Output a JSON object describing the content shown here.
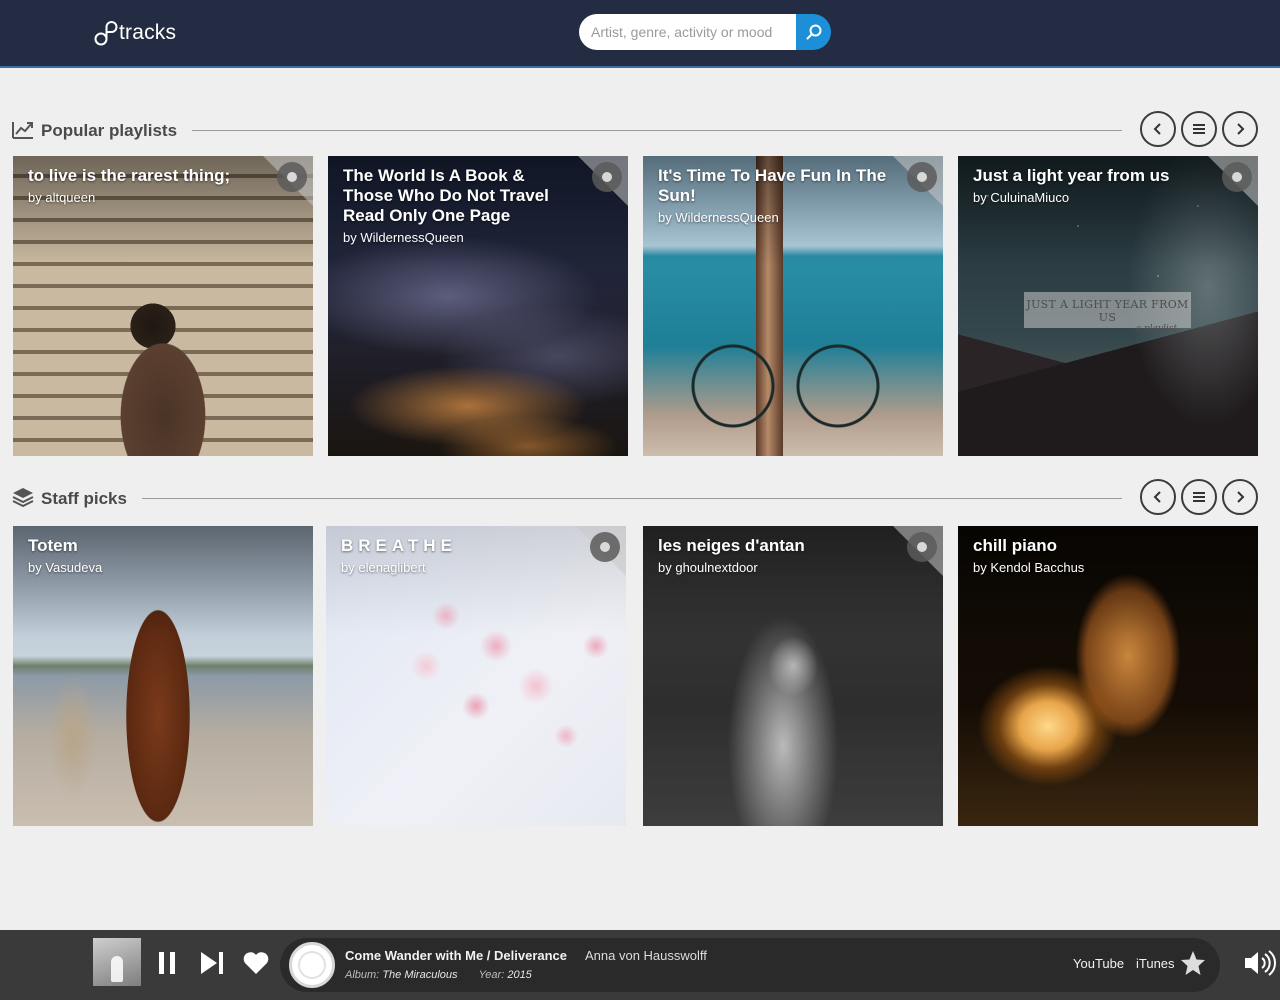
{
  "app": {
    "logo_text": "tracks"
  },
  "search": {
    "placeholder": "Artist, genre, activity or mood"
  },
  "sections": [
    {
      "title": "Popular playlists",
      "icon": "trending-icon",
      "cards": [
        {
          "title": "to live is the rarest thing;",
          "by": "by altqueen",
          "corner": true,
          "image": "library-woman"
        },
        {
          "title": "The World Is A Book & Those Who Do Not Travel Read Only One Page",
          "by": "by WildernessQueen",
          "corner": true,
          "image": "night-earth"
        },
        {
          "title": "It's Time To Have Fun In The Sun!",
          "by": "by WildernessQueen",
          "corner": true,
          "image": "beach-bicycle"
        },
        {
          "title": "Just a light year from us",
          "by": "by CuluinaMiuco",
          "corner": true,
          "image": "starry-mountains",
          "overlay_text": "JUST A LIGHT YEAR FROM US",
          "overlay_sub": "a playlist"
        }
      ]
    },
    {
      "title": "Staff picks",
      "icon": "layers-icon",
      "cards": [
        {
          "title": "Totem",
          "by": "by Vasudeva",
          "corner": false,
          "image": "totem-beach"
        },
        {
          "title": "BREATHE",
          "by": "by elenaglibert",
          "corner": true,
          "image": "cherry-blossom"
        },
        {
          "title": "les neiges d'antan",
          "by": "by ghoulnextdoor",
          "corner": true,
          "image": "ghost-woman"
        },
        {
          "title": "chill piano",
          "by": "by Kendol Bacchus",
          "corner": false,
          "image": "lamp-glow"
        }
      ]
    }
  ],
  "player": {
    "title": "Come Wander with Me / Deliverance",
    "artist": "Anna von Hausswolff",
    "album_label": "Album:",
    "album": "The Miraculous",
    "year_label": "Year:",
    "year": "2015",
    "links": [
      "YouTube",
      "iTunes"
    ]
  },
  "colors": {
    "header": "#232c42",
    "accent": "#1d8fd8",
    "player": "#3a3a3a"
  }
}
